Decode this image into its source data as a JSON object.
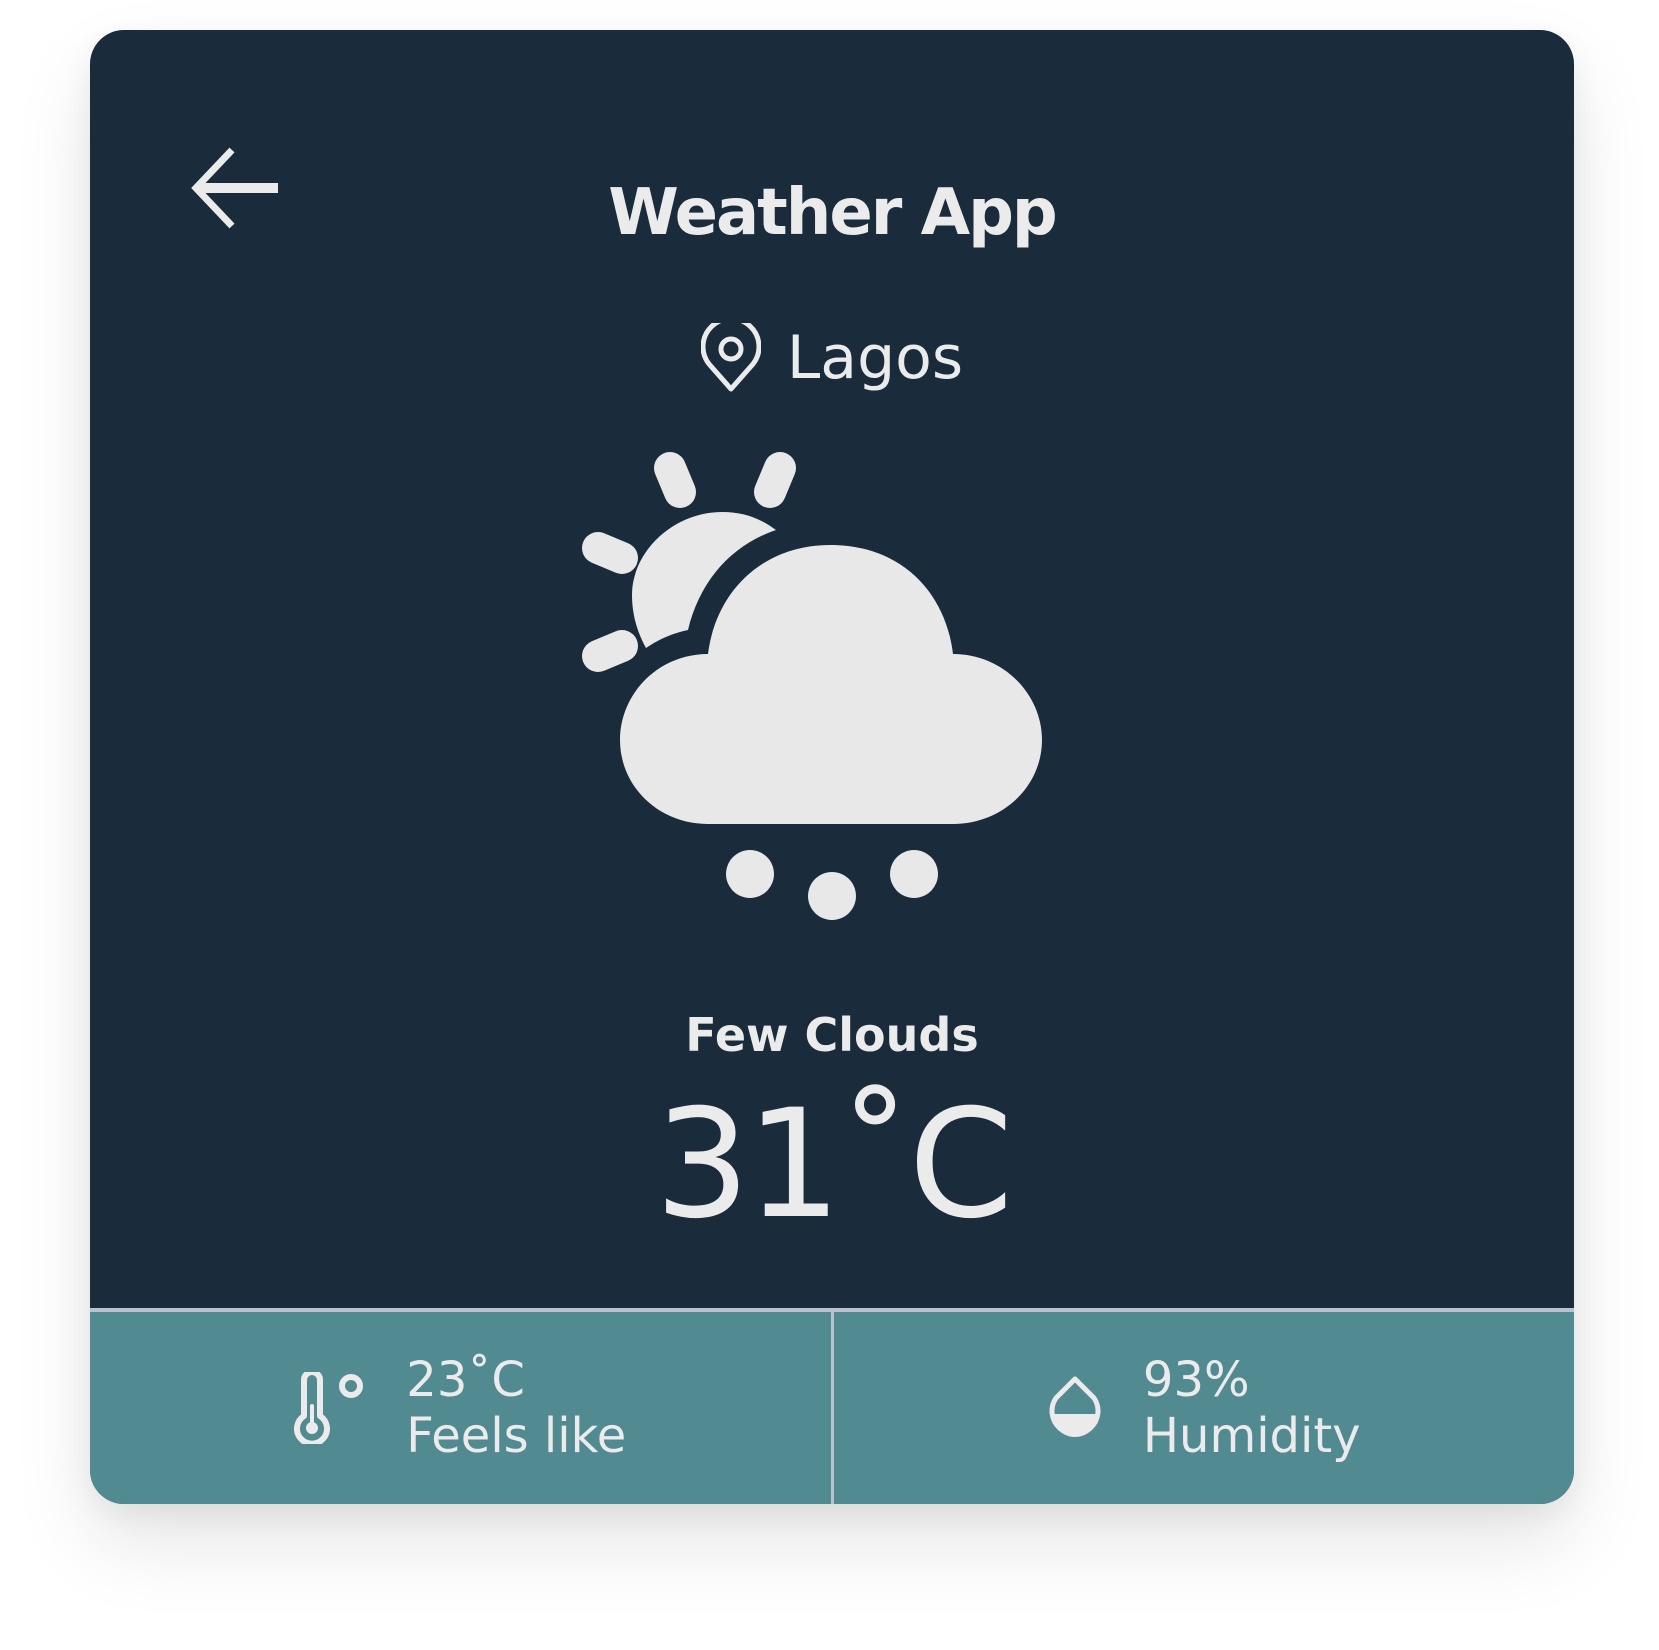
{
  "app": {
    "title": "Weather App"
  },
  "location": {
    "name": "Lagos",
    "icon": "map-pin-icon"
  },
  "weather": {
    "condition": "Few Clouds",
    "temperature": "31˚C",
    "icon": "sun-cloud-rain-icon"
  },
  "stats": {
    "feels_like": {
      "value": "23˚C",
      "label": "Feels like",
      "icon": "thermometer-icon"
    },
    "humidity": {
      "value": "93%",
      "label": "Humidity",
      "icon": "droplet-icon"
    }
  },
  "colors": {
    "card_background": "#1a2b3c",
    "footer_background": "#528a92",
    "foreground": "#ebebeb",
    "divider": "#b8c3cd"
  }
}
